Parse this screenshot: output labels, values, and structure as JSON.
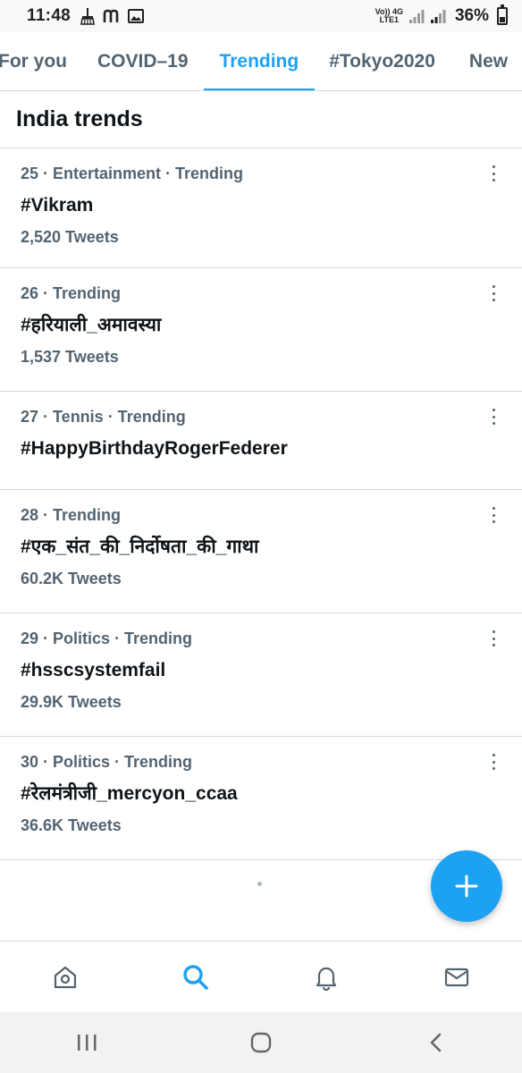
{
  "status_bar": {
    "time": "11:48",
    "left_icons": [
      "broom-icon",
      "m-notification-icon",
      "image-icon"
    ],
    "network_top": "Vo)) 4G",
    "network_bottom": "LTE1",
    "battery_percent": "36%",
    "battery_level": 0.36
  },
  "tabs": [
    {
      "label": "For you",
      "active": false
    },
    {
      "label": "COVID–19",
      "active": false
    },
    {
      "label": "Trending",
      "active": true
    },
    {
      "label": "#Tokyo2020",
      "active": false
    },
    {
      "label": "New",
      "active": false
    }
  ],
  "section": {
    "title": "India trends"
  },
  "trends": [
    {
      "meta": "25 · Entertainment · Trending",
      "name": "#Vikram",
      "count": "2,520 Tweets"
    },
    {
      "meta": "26 · Trending",
      "name": "#हरियाली_अमावस्या",
      "count": "1,537 Tweets"
    },
    {
      "meta": "27 · Tennis · Trending",
      "name": "#HappyBirthdayRogerFederer",
      "count": ""
    },
    {
      "meta": "28 · Trending",
      "name": "#एक_संत_की_निर्दोषता_की_गाथा",
      "count": "60.2K Tweets"
    },
    {
      "meta": "29 · Politics · Trending",
      "name": "#hsscsystemfail",
      "count": "29.9K Tweets"
    },
    {
      "meta": "30 · Politics · Trending",
      "name": "#रेलमंत्रीजी_mercyon_ccaa",
      "count": "36.6K Tweets"
    }
  ],
  "fab": {
    "icon": "plus-icon"
  },
  "bottom_nav": [
    {
      "name": "home",
      "icon": "home-icon",
      "active": false
    },
    {
      "name": "search",
      "icon": "search-icon",
      "active": true
    },
    {
      "name": "notifications",
      "icon": "bell-icon",
      "active": false
    },
    {
      "name": "messages",
      "icon": "mail-icon",
      "active": false
    }
  ],
  "colors": {
    "accent": "#1da1f2",
    "text_primary": "#0f1419",
    "text_secondary": "#536471",
    "divider": "#cfd9de"
  }
}
